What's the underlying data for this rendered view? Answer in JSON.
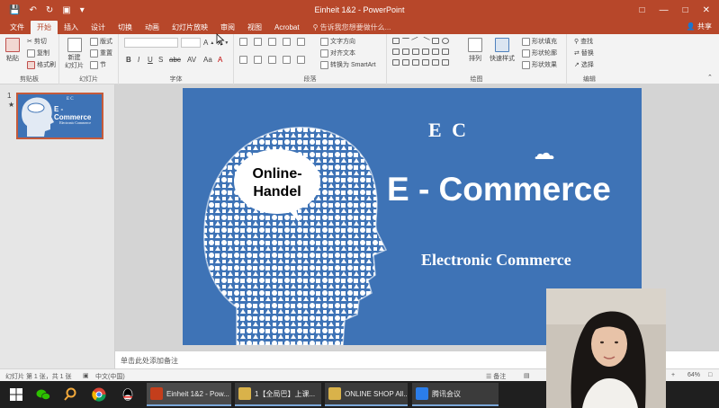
{
  "app": {
    "title": "Einheit 1&2 - PowerPoint",
    "share_label": "共享",
    "tell_me": "告诉我您想要做什么..."
  },
  "tabs": [
    "文件",
    "开始",
    "插入",
    "设计",
    "切换",
    "动画",
    "幻灯片放映",
    "审阅",
    "视图",
    "Acrobat"
  ],
  "active_tab": "开始",
  "ribbon": {
    "clipboard": {
      "label": "剪贴板",
      "paste": "粘贴",
      "cut": "剪切",
      "copy": "复制",
      "format_painter": "格式刷"
    },
    "slides": {
      "label": "幻灯片",
      "new_slide": "新建\n幻灯片",
      "layout": "版式",
      "reset": "重置",
      "section": "节"
    },
    "font": {
      "label": "字体"
    },
    "paragraph": {
      "label": "段落",
      "text_direction": "文字方向",
      "align_text": "对齐文本",
      "convert_smartart": "转换为 SmartArt"
    },
    "drawing": {
      "label": "绘图",
      "arrange": "排列",
      "quick_styles": "快速样式",
      "shape_fill": "形状填充",
      "shape_outline": "形状轮廓",
      "shape_effects": "形状效果"
    },
    "editing": {
      "label": "编辑",
      "find": "查找",
      "replace": "替换",
      "select": "选择"
    }
  },
  "slides_pane": {
    "slide_number": "1",
    "thumb_ec": "E C",
    "thumb_title": "E - Commerce",
    "thumb_sub": "Electronic Commerce"
  },
  "slide": {
    "speech_line1": "Online-",
    "speech_line2": "Handel",
    "ec": "E C",
    "title": "E - Commerce",
    "subtitle": "Electronic Commerce"
  },
  "notes_placeholder": "单击此处添加备注",
  "status": {
    "slide_info": "幻灯片 第 1 张，共 1 张",
    "language": "中文(中国)",
    "notes": "备注",
    "zoom": "64%"
  },
  "taskbar": {
    "apps": [
      {
        "label": "Einheit 1&2 - Pow...",
        "color": "#c43e1c"
      },
      {
        "label": "1【全局巴】上课...",
        "color": "#d9b24a"
      },
      {
        "label": "ONLINE SHOP All...",
        "color": "#d9b24a"
      },
      {
        "label": "腾讯会议",
        "color": "#2b7de9"
      }
    ]
  },
  "colors": {
    "accent": "#b7472a",
    "slide_bg": "#3e73b6"
  }
}
